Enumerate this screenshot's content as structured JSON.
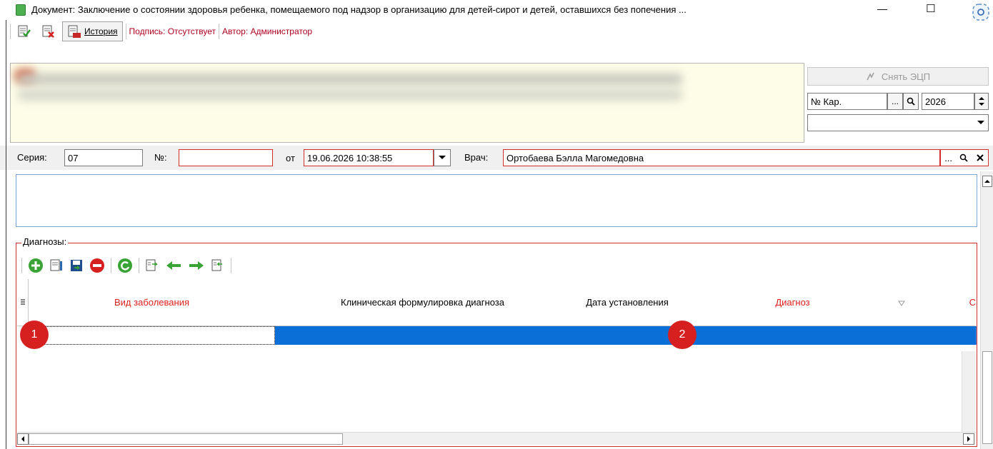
{
  "window": {
    "title": "Документ: Заключение о состоянии здоровья ребенка, помещаемого под надзор в организацию для детей-сирот и детей, оставшихся без попечения ...",
    "minimize": "—",
    "maximize": "☐"
  },
  "toolbar": {
    "history_label": "История",
    "signature_text": "Подпись: Отсутствует",
    "author_text": "Автор: Администратор"
  },
  "right_panel": {
    "remove_sign_label": "Снять ЭЦП",
    "card_no_placeholder": "№ Кар.",
    "year_value": "2026",
    "dots": "..."
  },
  "doc": {
    "series_label": "Серия:",
    "series_value": "07",
    "number_label": "№:",
    "number_value": "",
    "from_label": "от",
    "date_value": "19.06.2026 10:38:55",
    "doctor_label": "Врач:",
    "doctor_value": "Ортобаева Бэлла Магомедовна"
  },
  "diagnoses": {
    "group_label": "Диагнозы:",
    "columns": [
      {
        "label": "Вид заболевания",
        "color": "#e02020"
      },
      {
        "label": "Клиническая формулировка диагноза",
        "color": "#000000"
      },
      {
        "label": "Дата установления",
        "color": "#000000"
      },
      {
        "label": "Диагноз",
        "color": "#e02020"
      },
      {
        "label": "С",
        "color": "#e02020"
      }
    ],
    "markers": [
      "1",
      "2"
    ]
  },
  "colors": {
    "selection": "#0a6fd6",
    "required_border": "#d32f2f",
    "info_bg": "#fdfde8"
  }
}
